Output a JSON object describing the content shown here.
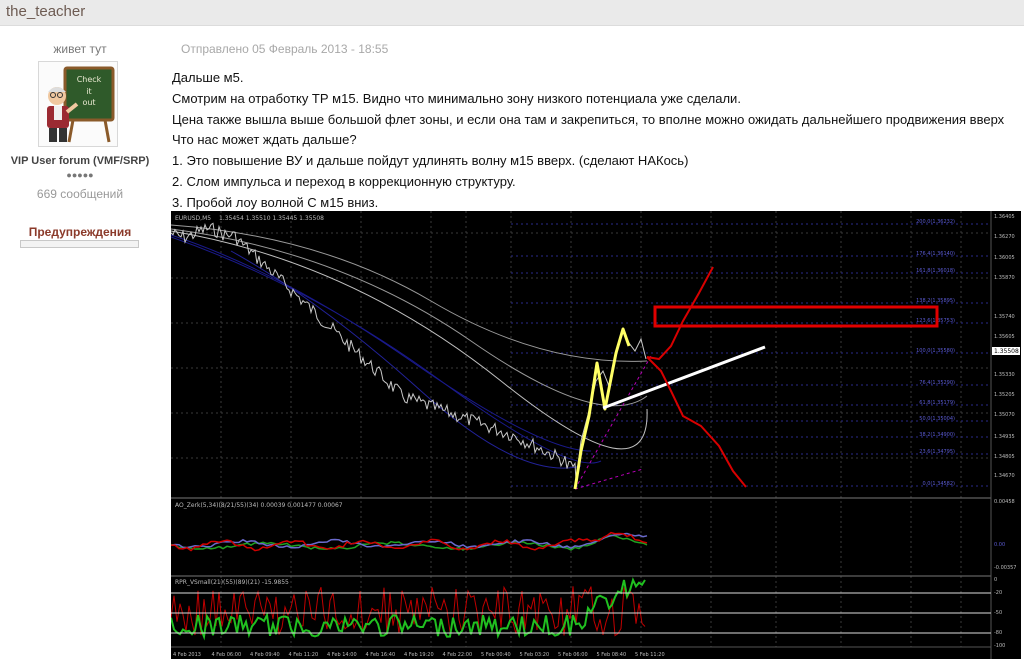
{
  "header": {
    "username": "the_teacher"
  },
  "author": {
    "rank_title": "живет тут",
    "avatar": "teacher-at-chalkboard",
    "avatar_board_text": [
      "Check",
      "it",
      "out"
    ],
    "group": "VIP User forum (VMF/SRP)",
    "rank_pips": "●●●●●",
    "posts": "669 сообщений",
    "warnings_label": "Предупреждения"
  },
  "post": {
    "posted": "Отправлено 05 Февраль 2013 - 18:55",
    "lines": [
      "Дальше м5.",
      "Смотрим на отработку ТР м15. Видно что минимально зону низкого потенциала уже сделали.",
      "Цена также вышла выше большой флет зоны, и если она там и закрепиться, то вполне можно ожидать дальнейшего продвижения вверх",
      "Что нас может ждать дальше?",
      "1. Это повышение ВУ и дальше пойдут удлинять волну м15 вверх. (сделают НАКось)",
      "2. Слом импульса и переход в коррекционную структуру.",
      "3. Пробой лоу волной С м15 вниз."
    ]
  },
  "chart": {
    "symbol": "EURUSD,M5",
    "ohlc": "1.35454 1.35510 1.35445 1.35508",
    "ind1_label": "AO_Zerk(5,34)(8/21/55)(34)  0.00039  0.001477  0.00067",
    "ind2_label": "RPR_VSmall(21)(55)(89)(21)  -15.9855",
    "fib_labels": [
      "200.0(1.36232)",
      "176.4(1.36140)",
      "161.8(1.36018)",
      "138.2(1.35895)",
      "123.6(1.35753)",
      "100.0(1.35580)",
      "76.4(1.35290)",
      "61.8(1.35179)",
      "50.0(1.35004)",
      "38.2(1.34900)",
      "23.6(1.34795)",
      "0.0(1.34582)"
    ],
    "price_ticks": [
      "1.36405",
      "1.36270",
      "1.36005",
      "1.35870",
      "1.35740",
      "1.35605",
      "1.35330",
      "1.35205",
      "1.35070",
      "1.34935",
      "1.34805",
      "1.34670"
    ],
    "price_badge": "1.35508",
    "ind1_ticks": [
      "0.00458",
      "0.00",
      "-0.00357"
    ],
    "ind2_ticks": [
      "0",
      "-20",
      "-50",
      "-80",
      "-100"
    ],
    "time_ticks": [
      "4 Feb 2013",
      "4 Feb 06:00",
      "4 Feb 09:40",
      "4 Feb 11:20",
      "4 Feb 14:00",
      "4 Feb 16:40",
      "4 Feb 19:20",
      "4 Feb 22:00",
      "5 Feb 00:40",
      "5 Feb 03:20",
      "5 Feb 06:00",
      "5 Feb 08:40",
      "5 Feb 11:20"
    ],
    "colors": {
      "bg": "#000000",
      "price": "#c8c8c8",
      "wave": "#ffff66",
      "scenario": "#d80000",
      "box": "#e00000",
      "arrow": "#ffffff",
      "ema": "#1a1a8c"
    }
  }
}
